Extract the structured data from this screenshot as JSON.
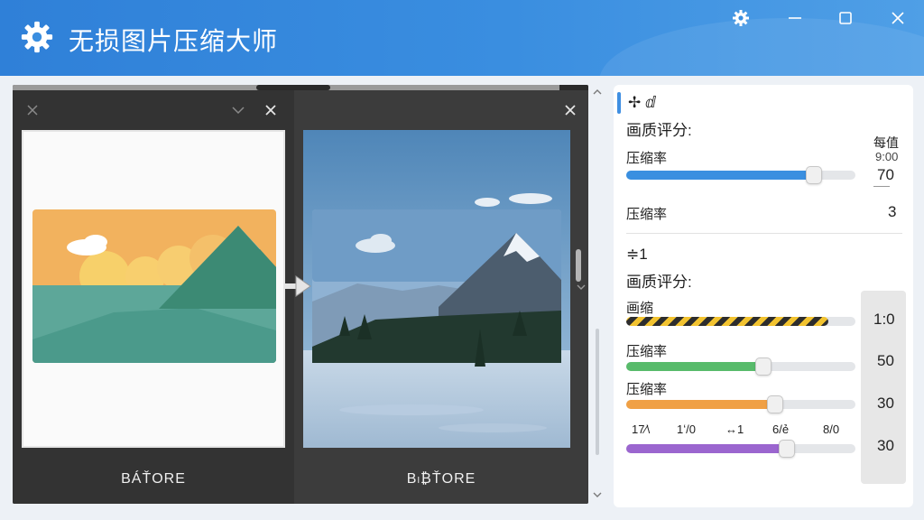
{
  "app": {
    "title": "无损图片压缩大师",
    "icon": "gear-icon",
    "titlebar_buttons": [
      "settings-icon",
      "minimize-icon",
      "maximize-icon",
      "close-icon"
    ]
  },
  "preview": {
    "left_label": "BÁŤORE",
    "right_label": "Bₗ₿ŤORE"
  },
  "settings": {
    "section1": {
      "header": "✢ ⅆ",
      "title": "画质评分:",
      "hint_line1": "每值",
      "hint_line2": "9:00",
      "slider_label": "压缩率",
      "slider_value": "70",
      "slider_percent": 0.82,
      "stat_label": "压缩率",
      "stat_value": "3"
    },
    "section2": {
      "header": "≑1",
      "title": "画质评分:",
      "rows": [
        {
          "label": "画缩",
          "value": "1:0",
          "percent": 0.88,
          "color": "#f2c330",
          "style": "striped"
        },
        {
          "label": "压缩率",
          "value": "50",
          "percent": 0.6,
          "color": "#58bb6b",
          "style": "solid"
        },
        {
          "label": "压缩率",
          "value": "30",
          "percent": 0.65,
          "color": "#f0a045",
          "style": "solid"
        }
      ],
      "tick_labels": [
        "17⁄\\",
        "1ʻ/0",
        "↔1",
        "6/ẻ",
        "8/0"
      ],
      "last_row": {
        "value": "30",
        "percent": 0.7,
        "color": "#9b66cf"
      }
    }
  },
  "colors": {
    "titlebar": "#3a8ee0",
    "accent": "#3f8fe2",
    "slider_blue": "#3a8fe0"
  }
}
